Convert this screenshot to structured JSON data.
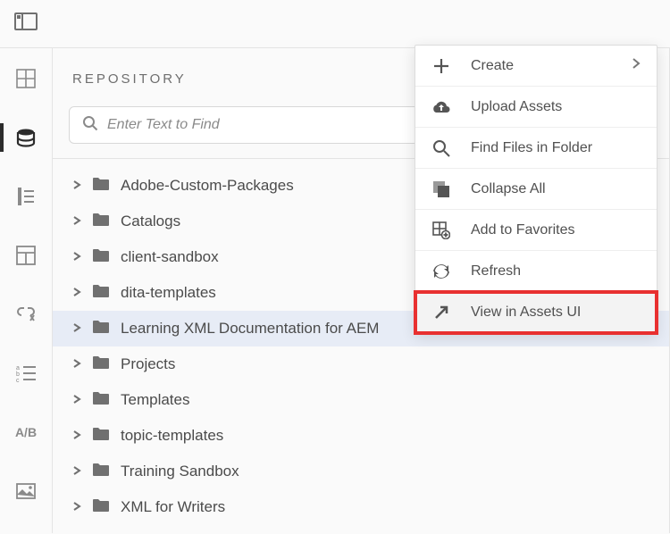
{
  "panel": {
    "title": "REPOSITORY",
    "search_placeholder": "Enter Text to Find"
  },
  "tree": {
    "items": [
      {
        "label": "Adobe-Custom-Packages",
        "selected": false
      },
      {
        "label": "Catalogs",
        "selected": false
      },
      {
        "label": "client-sandbox",
        "selected": false
      },
      {
        "label": "dita-templates",
        "selected": false
      },
      {
        "label": "Learning XML Documentation for AEM",
        "selected": true
      },
      {
        "label": "Projects",
        "selected": false
      },
      {
        "label": "Templates",
        "selected": false
      },
      {
        "label": "topic-templates",
        "selected": false
      },
      {
        "label": "Training Sandbox",
        "selected": false
      },
      {
        "label": "XML for Writers",
        "selected": false
      }
    ]
  },
  "menu": {
    "create": "Create",
    "upload": "Upload Assets",
    "find": "Find Files in Folder",
    "collapse": "Collapse All",
    "favorites": "Add to Favorites",
    "refresh": "Refresh",
    "view_assets": "View in Assets UI"
  },
  "rail": {
    "ab": "A/B"
  }
}
